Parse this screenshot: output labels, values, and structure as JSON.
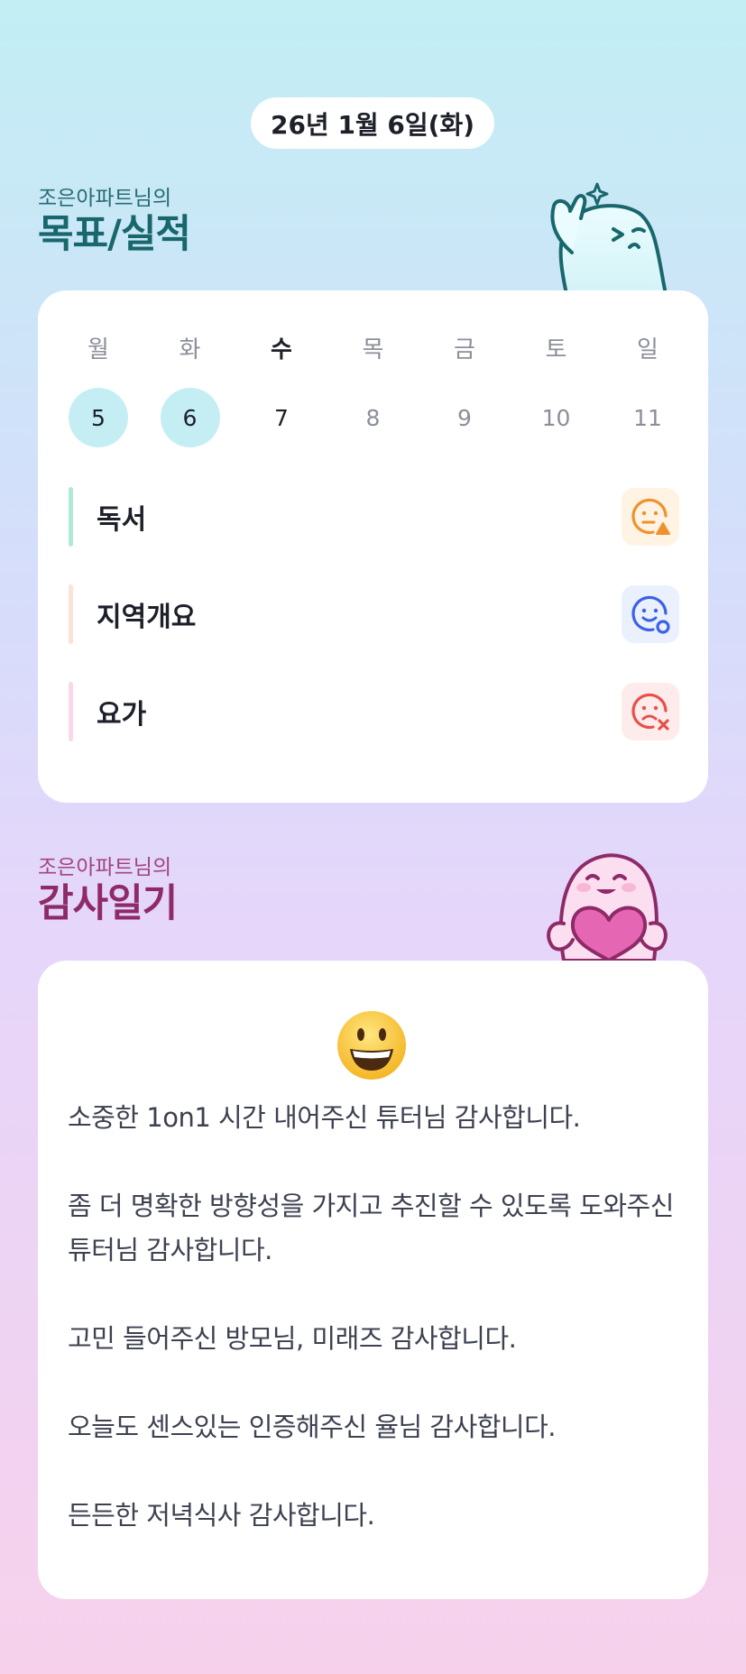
{
  "date_label": "26년 1월 6일(화)",
  "goals_section": {
    "subtitle": "조은아파트님의",
    "title": "목표/실적"
  },
  "week": [
    {
      "day": "월",
      "date": "5",
      "state": "done"
    },
    {
      "day": "화",
      "date": "6",
      "state": "done"
    },
    {
      "day": "수",
      "date": "7",
      "state": "today"
    },
    {
      "day": "목",
      "date": "8",
      "state": "future"
    },
    {
      "day": "금",
      "date": "9",
      "state": "future"
    },
    {
      "day": "토",
      "date": "10",
      "state": "future"
    },
    {
      "day": "일",
      "date": "11",
      "state": "future"
    }
  ],
  "goals": [
    {
      "label": "독서",
      "status_icon": "face-triangle-icon",
      "bar_color": "#aeebd6",
      "status_color": "#f0912e",
      "status_bg": "#fff3e4"
    },
    {
      "label": "지역개요",
      "status_icon": "face-circle-icon",
      "bar_color": "#fde2d6",
      "status_color": "#3b61e8",
      "status_bg": "#ebf0fd"
    },
    {
      "label": "요가",
      "status_icon": "face-x-icon",
      "bar_color": "#fbd6ec",
      "status_color": "#e8504a",
      "status_bg": "#fdeceb"
    }
  ],
  "thanks_section": {
    "subtitle": "조은아파트님의",
    "title": "감사일기"
  },
  "diary": {
    "emoji": "grinning-face-icon",
    "paragraphs": [
      "소중한 1on1 시간 내어주신 튜터님 감사합니다.",
      "좀 더 명확한 방향성을 가지고 추진할 수 있도록 도와주신 튜터님 감사합니다.",
      "고민 들어주신 방모님, 미래즈 감사합니다.",
      "오늘도 센스있는 인증해주신 율님 감사합니다.",
      "든든한 저녁식사 감사합니다."
    ]
  }
}
